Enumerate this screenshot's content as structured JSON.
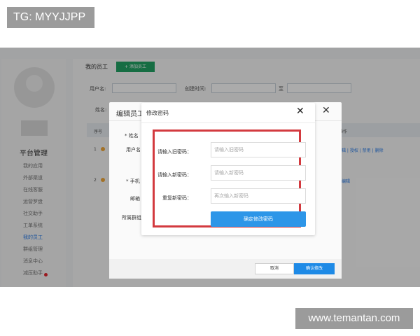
{
  "watermarks": {
    "top": "TG: MYYJJPP",
    "bottom": "www.temantan.com"
  },
  "sidebar": {
    "title": "平台管理",
    "items": [
      {
        "label": "我的应用"
      },
      {
        "label": "外部渠道"
      },
      {
        "label": "在线客服"
      },
      {
        "label": "运营罗盘"
      },
      {
        "label": "社交助手"
      },
      {
        "label": "工单系统"
      },
      {
        "label": "我的员工",
        "active": true
      },
      {
        "label": "群组管理"
      },
      {
        "label": "消息中心",
        "badge": true
      },
      {
        "label": "减压助手"
      }
    ]
  },
  "main": {
    "page_title": "我的员工",
    "add_button": "+ 添加员工",
    "filters": {
      "username_label": "用户名:",
      "created_label": "创建时间:",
      "to_label": "至",
      "name_label": "姓名:"
    },
    "table": {
      "col_index": "序号",
      "col_ops": "操作",
      "rows": [
        {
          "index": "1",
          "ops": "编辑 | 授权 | 禁用 | 删除"
        },
        {
          "index": "2",
          "ops": "编辑"
        }
      ]
    }
  },
  "edit_dialog": {
    "title": "编辑员工",
    "close": "✕",
    "fields": {
      "name": "* 姓名",
      "username": "用户名",
      "phone": "* 手机",
      "email": "邮箱",
      "group": "所属群组"
    },
    "cancel": "取消",
    "confirm": "确认修改"
  },
  "password_dialog": {
    "title": "修改密码",
    "close": "✕",
    "old_label": "请输入旧密码：",
    "old_placeholder": "请输入旧密码",
    "new_label": "请输入新密码：",
    "new_placeholder": "请输入新密码",
    "repeat_label": "重复新密码：",
    "repeat_placeholder": "再次输入新密码",
    "confirm": "确定修改密码"
  },
  "colors": {
    "highlight": "#d33a3f",
    "primary": "#2d96e8",
    "add_button": "#21a365"
  }
}
